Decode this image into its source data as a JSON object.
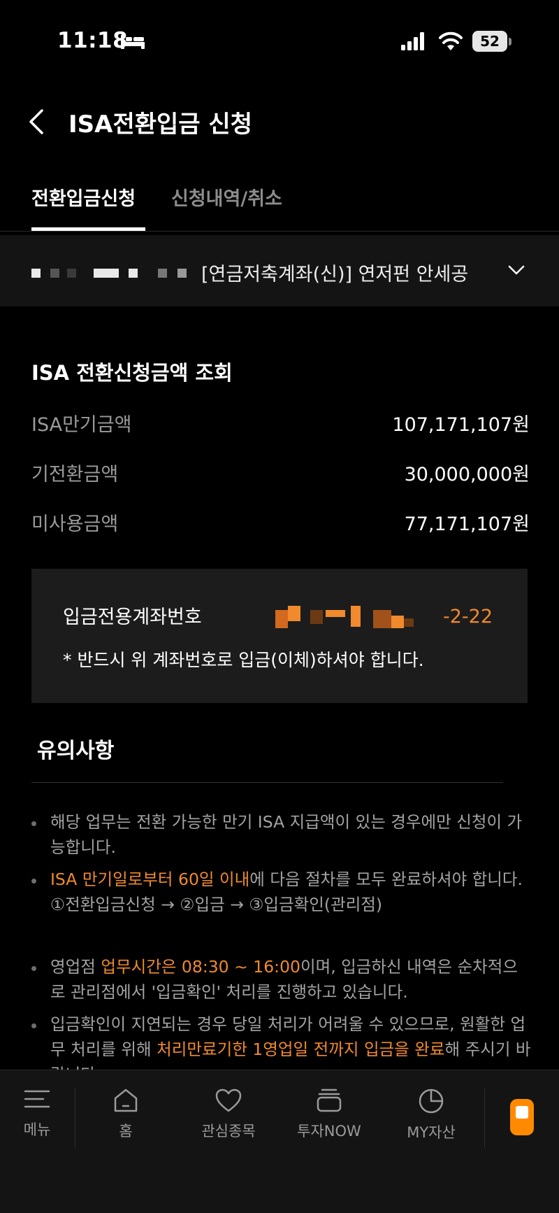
{
  "status_bar": {
    "time": "11:18",
    "battery": "52"
  },
  "header": {
    "title": "ISA전환입금 신청"
  },
  "tabs": [
    {
      "label": "전환입금신청",
      "active": true
    },
    {
      "label": "신청내역/취소",
      "active": false
    }
  ],
  "account_selector": {
    "label": "[연금저축계좌(신)] 연저펀 안세공"
  },
  "summary": {
    "title": "ISA 전환신청금액 조회",
    "rows": [
      {
        "label": "ISA만기금액",
        "value": "107,171,107원"
      },
      {
        "label": "기전환금액",
        "value": "30,000,000원"
      },
      {
        "label": "미사용금액",
        "value": "77,171,107원"
      }
    ]
  },
  "deposit_account": {
    "title": "입금전용계좌번호",
    "account_suffix": "-2-22",
    "note": "* 반드시 위 계좌번호로 입금(이체)하셔야 합니다."
  },
  "notes": {
    "title": "유의사항",
    "items": [
      {
        "text": "해당 업무는 전환 가능한 만기 ISA 지급액이 있는 경우에만 신청이 가능합니다."
      },
      {
        "highlight": "ISA 만기일로부터 60일 이내",
        "text": "에 다음 절차를 모두 완료하셔야 합니다.",
        "line2": "①전환입금신청 → ②입금 → ③입금확인(관리점)"
      },
      {
        "pre": "영업점 ",
        "highlight": "업무시간은 08:30 ~ 16:00",
        "text": "이며, 입금하신 내역은 순차적으로 관리점에서 '입금확인' 처리를 진행하고 있습니다."
      },
      {
        "pre": "입금확인이 지연되는 경우 당일 처리가 어려울 수 있으므로, 원활한 업무 처리를 위해 ",
        "highlight": "처리만료기한 1영업일 전까지 입금을 완료",
        "text": "해 주시기 바랍니다."
      }
    ]
  },
  "bottom_nav": {
    "items": [
      {
        "label": "메뉴",
        "icon": "menu-icon"
      },
      {
        "label": "홈",
        "icon": "home-icon"
      },
      {
        "label": "관심종목",
        "icon": "heart-icon"
      },
      {
        "label": "투자NOW",
        "icon": "stack-icon"
      },
      {
        "label": "MY자산",
        "icon": "pie-chart-icon"
      }
    ],
    "chat": {
      "icon": "chat-icon"
    }
  },
  "colors": {
    "accent": "#f08a2c",
    "background": "#000000",
    "chat": "#ff8a00"
  }
}
